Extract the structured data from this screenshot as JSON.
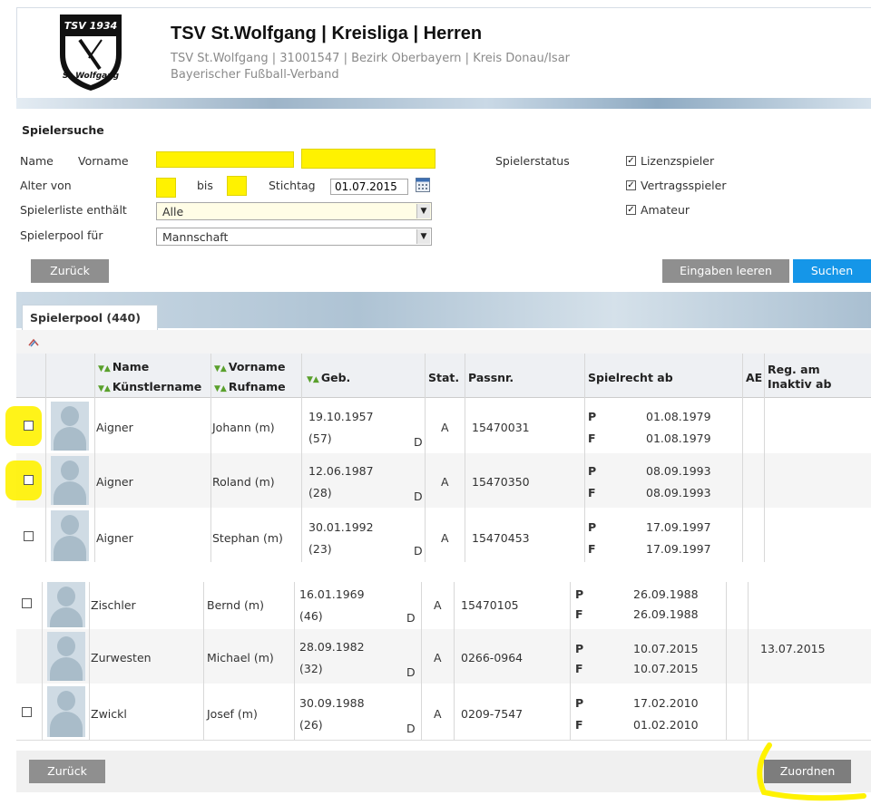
{
  "header": {
    "title": "TSV St.Wolfgang | Kreisliga | Herren",
    "subtitle_line1": "TSV St.Wolfgang | 31001547 | Bezirk Oberbayern | Kreis Donau/Isar",
    "subtitle_line2": "Bayerischer Fußball-Verband",
    "logo_text_top": "TSV 1934",
    "logo_text_bottom": "St.Wolfgang"
  },
  "search": {
    "heading": "Spielersuche",
    "name_label": "Name",
    "vorname_label": "Vorname",
    "name_value": "",
    "vorname_value": "",
    "alter_label": "Alter von",
    "bis_label": "bis",
    "alter_from": "",
    "alter_to": "",
    "stichtag_label": "Stichtag",
    "stichtag_value": "01.07.2015",
    "liste_label": "Spielerliste enthält",
    "liste_value": "Alle",
    "pool_label": "Spielerpool für",
    "pool_value": "Mannschaft",
    "status_label": "Spielerstatus",
    "status_options": [
      {
        "label": "Lizenzspieler",
        "checked": true
      },
      {
        "label": "Vertragsspieler",
        "checked": true
      },
      {
        "label": "Amateur",
        "checked": true
      }
    ],
    "back_button": "Zurück",
    "clear_button": "Eingaben leeren",
    "search_button": "Suchen"
  },
  "tab": {
    "label": "Spielerpool (440)"
  },
  "columns": {
    "name": "Name",
    "kuenstlername": "Künstlername",
    "vorname": "Vorname",
    "rufname": "Rufname",
    "geb": "Geb.",
    "stat": "Stat.",
    "passnr": "Passnr.",
    "spielrecht": "Spielrecht ab",
    "ae": "AE",
    "reg1": "Reg. am",
    "reg2": "Inaktiv ab"
  },
  "rows": [
    {
      "name": "Aigner",
      "vorname": "Johann (m)",
      "geb": "19.10.1957",
      "age": "(57)",
      "nat": "D",
      "stat": "A",
      "passnr": "15470031",
      "p_label": "P",
      "f_label": "F",
      "p_date": "01.08.1979",
      "f_date": "01.08.1979",
      "reg": ""
    },
    {
      "name": "Aigner",
      "vorname": "Roland (m)",
      "geb": "12.06.1987",
      "age": "(28)",
      "nat": "D",
      "stat": "A",
      "passnr": "15470350",
      "p_label": "P",
      "f_label": "F",
      "p_date": "08.09.1993",
      "f_date": "08.09.1993",
      "reg": ""
    },
    {
      "name": "Aigner",
      "vorname": "Stephan (m)",
      "geb": "30.01.1992",
      "age": "(23)",
      "nat": "D",
      "stat": "A",
      "passnr": "15470453",
      "p_label": "P",
      "f_label": "F",
      "p_date": "17.09.1997",
      "f_date": "17.09.1997",
      "reg": ""
    },
    {
      "name": "Zischler",
      "vorname": "Bernd (m)",
      "geb": "16.01.1969",
      "age": "(46)",
      "nat": "D",
      "stat": "A",
      "passnr": "15470105",
      "p_label": "P",
      "f_label": "F",
      "p_date": "26.09.1988",
      "f_date": "26.09.1988",
      "reg": ""
    },
    {
      "name": "Zurwesten",
      "vorname": "Michael (m)",
      "geb": "28.09.1982",
      "age": "(32)",
      "nat": "D",
      "stat": "A",
      "passnr": "0266-0964",
      "p_label": "P",
      "f_label": "F",
      "p_date": "10.07.2015",
      "f_date": "10.07.2015",
      "reg": "13.07.2015"
    },
    {
      "name": "Zwickl",
      "vorname": "Josef (m)",
      "geb": "30.09.1988",
      "age": "(26)",
      "nat": "D",
      "stat": "A",
      "passnr": "0209-7547",
      "p_label": "P",
      "f_label": "F",
      "p_date": "17.02.2010",
      "f_date": "01.02.2010",
      "reg": ""
    }
  ],
  "footer": {
    "back_button": "Zurück",
    "assign_button": "Zuordnen"
  },
  "colors": {
    "accent": "#1596e8",
    "highlight": "#fff200",
    "button_grey": "#8f8f8f"
  }
}
